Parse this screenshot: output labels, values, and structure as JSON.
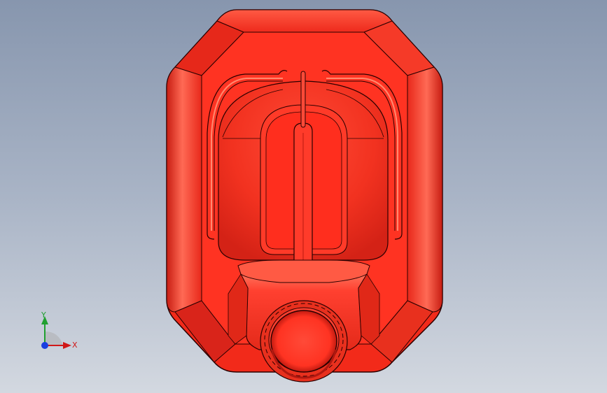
{
  "viewport": {
    "background_top": "#8796ae",
    "background_bottom": "#d3d8e0"
  },
  "model": {
    "part": "jerrycan",
    "color": "#ff3322",
    "edge_color": "#2a0000"
  },
  "triad": {
    "y_label": "Y",
    "x_label": "X",
    "y_color": "#20a030",
    "x_color": "#d01818",
    "z_color": "#1a3ee0"
  }
}
